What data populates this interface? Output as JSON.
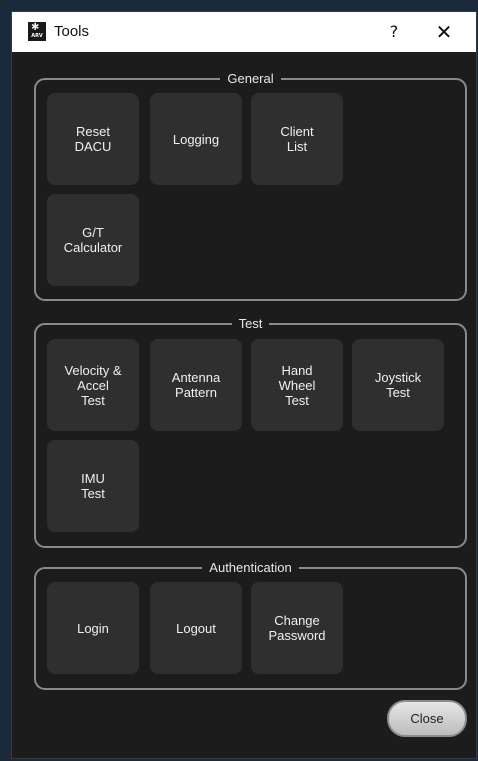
{
  "window": {
    "title": "Tools",
    "help_label": "?",
    "close_label": "✕",
    "icon_text": "ARV"
  },
  "groups": {
    "general": {
      "title": "General",
      "buttons": [
        "Reset\nDACU",
        "Logging",
        "Client\nList",
        "G/T\nCalculator"
      ]
    },
    "test": {
      "title": "Test",
      "buttons": [
        "Velocity &\nAccel\nTest",
        "Antenna\nPattern",
        "Hand\nWheel\nTest",
        "Joystick\nTest",
        "IMU\nTest"
      ]
    },
    "authentication": {
      "title": "Authentication",
      "buttons": [
        "Login",
        "Logout",
        "Change\nPassword"
      ]
    }
  },
  "footer": {
    "close_button": "Close"
  }
}
